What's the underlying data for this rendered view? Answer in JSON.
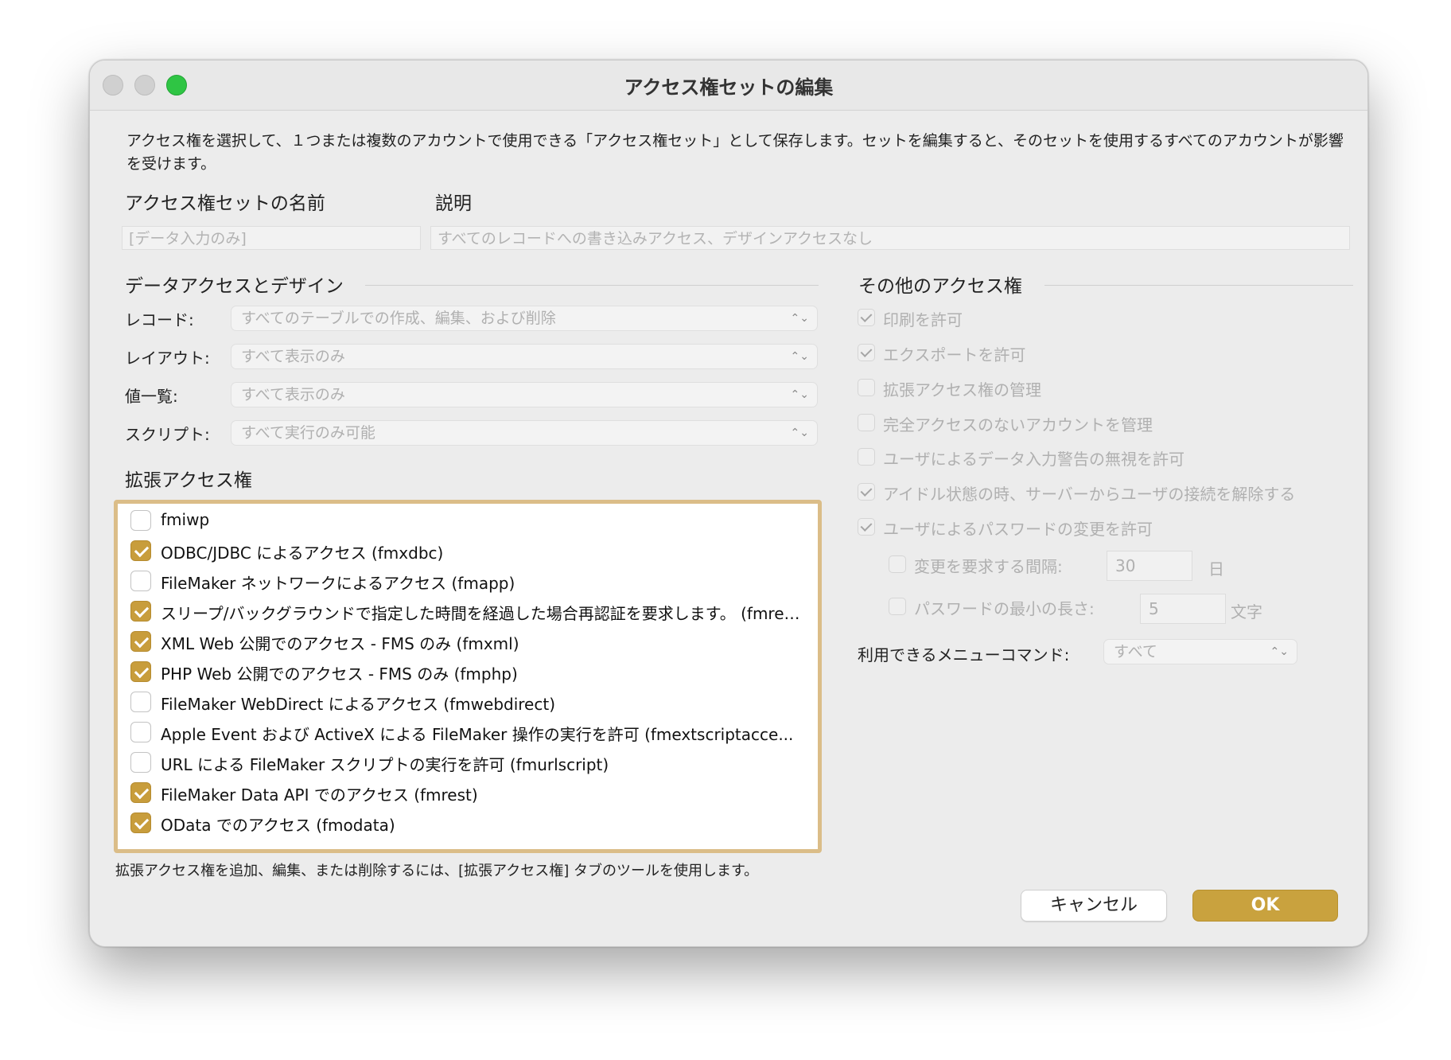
{
  "window": {
    "title": "アクセス権セットの編集"
  },
  "intro": "アクセス権を選択して、１つまたは複数のアカウントで使用できる「アクセス権セット」として保存します。セットを編集すると、そのセットを使用するすべてのアカウントが影響を受けます。",
  "name_field": {
    "label": "アクセス権セットの名前",
    "value": "[データ入力のみ]"
  },
  "desc_field": {
    "label": "説明",
    "value": "すべてのレコードへの書き込みアクセス、デザインアクセスなし"
  },
  "data_access": {
    "title": "データアクセスとデザイン",
    "rows": [
      {
        "label": "レコード:",
        "value": "すべてのテーブルでの作成、編集、および削除"
      },
      {
        "label": "レイアウト:",
        "value": "すべて表示のみ"
      },
      {
        "label": "値一覧:",
        "value": "すべて表示のみ"
      },
      {
        "label": "スクリプト:",
        "value": "すべて実行のみ可能"
      }
    ]
  },
  "extended": {
    "title": "拡張アクセス権",
    "items": [
      {
        "label": "fmiwp",
        "checked": false
      },
      {
        "label": "ODBC/JDBC によるアクセス (fmxdbc)",
        "checked": true
      },
      {
        "label": "FileMaker ネットワークによるアクセス (fmapp)",
        "checked": false
      },
      {
        "label": "スリープ/バックグラウンドで指定した時間を経過した場合再認証を要求します。 (fmrea...",
        "checked": true
      },
      {
        "label": "XML Web 公開でのアクセス - FMS のみ (fmxml)",
        "checked": true
      },
      {
        "label": "PHP Web 公開でのアクセス - FMS のみ (fmphp)",
        "checked": true
      },
      {
        "label": "FileMaker WebDirect によるアクセス (fmwebdirect)",
        "checked": false
      },
      {
        "label": "Apple Event および ActiveX による FileMaker 操作の実行を許可 (fmextscriptacce...",
        "checked": false
      },
      {
        "label": "URL による FileMaker スクリプトの実行を許可 (fmurlscript)",
        "checked": false
      },
      {
        "label": "FileMaker Data API でのアクセス (fmrest)",
        "checked": true
      },
      {
        "label": "OData でのアクセス (fmodata)",
        "checked": true
      }
    ],
    "note": "拡張アクセス権を追加、編集、または削除するには、[拡張アクセス権] タブのツールを使用します。"
  },
  "other": {
    "title": "その他のアクセス権",
    "items": [
      {
        "label": "印刷を許可",
        "checked": true
      },
      {
        "label": "エクスポートを許可",
        "checked": true
      },
      {
        "label": "拡張アクセス権の管理",
        "checked": false
      },
      {
        "label": "完全アクセスのないアカウントを管理",
        "checked": false
      },
      {
        "label": "ユーザによるデータ入力警告の無視を許可",
        "checked": false
      },
      {
        "label": "アイドル状態の時、サーバーからユーザの接続を解除する",
        "checked": true
      },
      {
        "label": "ユーザによるパスワードの変更を許可",
        "checked": true
      }
    ],
    "change_interval": {
      "label": "変更を要求する間隔:",
      "value": "30",
      "unit": "日",
      "checked": false
    },
    "min_length": {
      "label": "パスワードの最小の長さ:",
      "value": "5",
      "unit": "文字",
      "checked": false
    },
    "menu": {
      "label": "利用できるメニューコマンド:",
      "value": "すべて"
    }
  },
  "buttons": {
    "cancel": "キャンセル",
    "ok": "OK"
  },
  "colors": {
    "accent": "#c9a23e",
    "ext_border": "#dbbd88",
    "traffic_green": "#2fc544"
  }
}
